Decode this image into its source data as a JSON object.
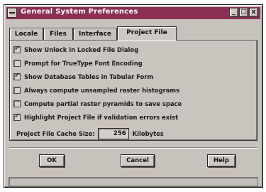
{
  "window": {
    "title": "General System Preferences",
    "title_buttons": [
      "_",
      "□",
      "x"
    ]
  },
  "tabs": [
    {
      "label": "Locale",
      "active": false
    },
    {
      "label": "Files",
      "active": false
    },
    {
      "label": "Interface",
      "active": false
    },
    {
      "label": "Project File",
      "active": true
    }
  ],
  "options": [
    {
      "label": "Show Unlock in Locked File Dialog",
      "checked": true
    },
    {
      "label": "Prompt for TrueType Font Encoding",
      "checked": false
    },
    {
      "label": "Show Database Tables in Tabular Form",
      "checked": true
    },
    {
      "label": "Always compute unsampled raster histograms",
      "checked": false
    },
    {
      "label": "Compute partial raster pyramids to save space",
      "checked": false
    },
    {
      "label": "Highlight Project File if validation errors exist",
      "checked": true
    }
  ],
  "cache": {
    "label": "Project File Cache Size:",
    "value": "256",
    "unit": "Kilobytes"
  },
  "buttons": {
    "ok": "OK",
    "cancel": "Cancel",
    "help": "Help"
  },
  "status": {
    "text": ""
  },
  "colors": {
    "titlebar": "#8c2f54",
    "face": "#c7c2bb"
  }
}
